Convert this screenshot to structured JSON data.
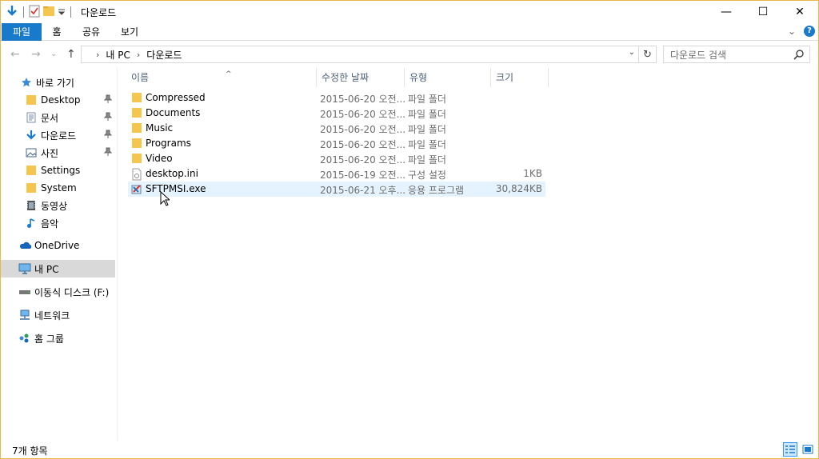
{
  "window": {
    "title": "다운로드",
    "controls": {
      "minimize": "—",
      "maximize": "☐",
      "close": "✕"
    }
  },
  "ribbon": {
    "tabs": [
      "파일",
      "홈",
      "공유",
      "보기"
    ],
    "expand": "⌄",
    "help": "?"
  },
  "nav": {
    "back": "←",
    "forward": "→",
    "recent": "⌄",
    "up": "↑",
    "breadcrumb": [
      "내 PC",
      "다운로드"
    ],
    "chevron": "›",
    "dropdown": "⌄",
    "refresh": "↻",
    "search_placeholder": "다운로드 검색"
  },
  "sidebar": {
    "quick_access": "바로 가기",
    "items": [
      {
        "label": "Desktop",
        "icon": "folder-icon",
        "pinned": true
      },
      {
        "label": "문서",
        "icon": "document-icon",
        "pinned": true
      },
      {
        "label": "다운로드",
        "icon": "download-icon",
        "pinned": true
      },
      {
        "label": "사진",
        "icon": "pictures-icon",
        "pinned": true
      },
      {
        "label": "Settings",
        "icon": "folder-icon",
        "pinned": false
      },
      {
        "label": "System",
        "icon": "folder-icon",
        "pinned": false
      },
      {
        "label": "동영상",
        "icon": "video-icon",
        "pinned": false
      },
      {
        "label": "음악",
        "icon": "music-icon",
        "pinned": false
      }
    ],
    "onedrive": "OneDrive",
    "this_pc": "내 PC",
    "removable": "이동식 디스크 (F:)",
    "network": "네트워크",
    "homegroup": "홈 그룹"
  },
  "columns": {
    "name": "이름",
    "date": "수정한 날짜",
    "type": "유형",
    "size": "크기",
    "sort_arrow": "^"
  },
  "files": [
    {
      "name": "Compressed",
      "date": "2015-06-20 오전...",
      "type": "파일 폴더",
      "size": "",
      "icon": "folder-icon"
    },
    {
      "name": "Documents",
      "date": "2015-06-20 오전...",
      "type": "파일 폴더",
      "size": "",
      "icon": "folder-icon"
    },
    {
      "name": "Music",
      "date": "2015-06-20 오전...",
      "type": "파일 폴더",
      "size": "",
      "icon": "folder-icon"
    },
    {
      "name": "Programs",
      "date": "2015-06-20 오전...",
      "type": "파일 폴더",
      "size": "",
      "icon": "folder-icon"
    },
    {
      "name": "Video",
      "date": "2015-06-20 오전...",
      "type": "파일 폴더",
      "size": "",
      "icon": "folder-icon"
    },
    {
      "name": "desktop.ini",
      "date": "2015-06-19 오전...",
      "type": "구성 설정",
      "size": "1KB",
      "icon": "settings-file-icon"
    },
    {
      "name": "SFTPMSI.exe",
      "date": "2015-06-21 오후...",
      "type": "응용 프로그램",
      "size": "30,824KB",
      "icon": "installer-icon"
    }
  ],
  "status": {
    "item_count": "7개 항목"
  },
  "colors": {
    "accent": "#1979ca",
    "folder": "#f5c64f",
    "border": "#e8b84a",
    "hover": "#e5f3ff",
    "selected": "#d9d9d9"
  }
}
